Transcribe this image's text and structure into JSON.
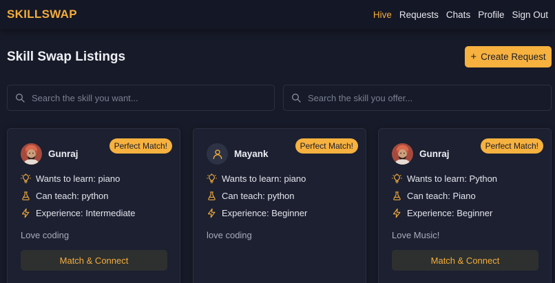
{
  "brand": "SKILLSWAP",
  "nav": [
    {
      "label": "Hive",
      "active": true
    },
    {
      "label": "Requests",
      "active": false
    },
    {
      "label": "Chats",
      "active": false
    },
    {
      "label": "Profile",
      "active": false
    },
    {
      "label": "Sign Out",
      "active": false
    }
  ],
  "page_title": "Skill Swap Listings",
  "create_button": {
    "icon": "plus",
    "label": "Create Request"
  },
  "search_want": {
    "placeholder": "Search the skill you want..."
  },
  "search_offer": {
    "placeholder": "Search the skill you offer..."
  },
  "cards": [
    {
      "name": "Gunraj",
      "avatar": "photo",
      "badge": "Perfect Match!",
      "wants": "Wants to learn: piano",
      "teaches": "Can teach: python",
      "experience": "Experience: Intermediate",
      "bio": "Love coding",
      "button": "Match & Connect"
    },
    {
      "name": "Mayank",
      "avatar": "user-icon",
      "badge": "Perfect Match!",
      "wants": "Wants to learn: piano",
      "teaches": "Can teach: python",
      "experience": "Experience: Beginner",
      "bio": "love coding"
    },
    {
      "name": "Gunraj",
      "avatar": "photo",
      "badge": "Perfect Match!",
      "wants": "Wants to learn: Python",
      "teaches": "Can teach: Piano",
      "experience": "Experience: Beginner",
      "bio": "Love Music!",
      "button": "Match & Connect"
    }
  ],
  "colors": {
    "accent": "#f6b13f",
    "background": "#171a28",
    "card": "#1c2031"
  }
}
